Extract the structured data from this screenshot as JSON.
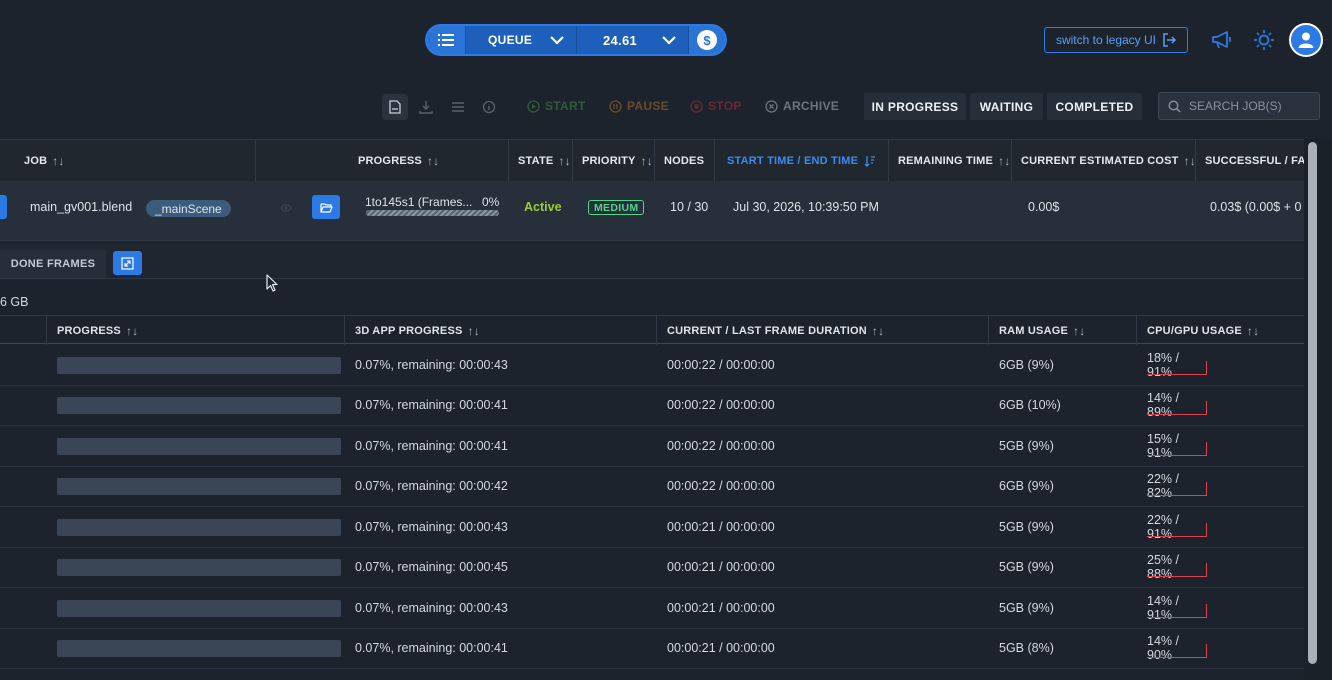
{
  "colors": {
    "background": "#1c232d",
    "accent": "#2c7be5",
    "active": "#9ccc3a",
    "medium_badge": "#4fd48a",
    "cpu_line": "#d9434e"
  },
  "topbar": {
    "queue_label": "QUEUE",
    "cost_value": "24.61",
    "legacy_label": "switch to legacy UI",
    "icons": [
      "list-icon",
      "chevron-down-icon",
      "dollar-icon",
      "megaphone-icon",
      "sun-icon",
      "user-icon"
    ]
  },
  "toolbar": {
    "actions": {
      "start": "START",
      "pause": "PAUSE",
      "stop": "STOP",
      "archive": "ARCHIVE"
    },
    "tabs": {
      "in_progress": "IN PROGRESS",
      "waiting": "WAITING",
      "completed": "COMPLETED"
    },
    "search_placeholder": "SEARCH JOB(S)"
  },
  "jobs_table": {
    "headers": {
      "job": "JOB",
      "progress": "PROGRESS",
      "state": "STATE",
      "priority": "PRIORITY",
      "nodes": "NODES",
      "start_end": "START TIME / END TIME",
      "remaining": "REMAINING TIME",
      "cost": "CURRENT ESTIMATED COST",
      "success": "SUCCESSFUL / FAI"
    },
    "row": {
      "job_name": "main_gv001.blend",
      "scene": "_mainScene",
      "progress_label": "1to145s1 (Frames...",
      "progress_pct": "0%",
      "progress_fraction": 0,
      "state": "Active",
      "priority": "MEDIUM",
      "nodes": "10 / 30",
      "start_time": "Jul 30, 2026, 10:39:50 PM",
      "cost": "0.00$",
      "success": "0.03$ (0.00$ + 0"
    }
  },
  "sub": {
    "done_frames": "DONE FRAMES",
    "ram_total": "6 GB",
    "headers": {
      "progress": "PROGRESS",
      "app_progress": "3D APP PROGRESS",
      "duration": "CURRENT / LAST FRAME DURATION",
      "ram": "RAM USAGE",
      "cpu": "CPU/GPU USAGE"
    },
    "rows": [
      {
        "app": "0.07%, remaining: 00:00:43",
        "duration": "00:00:22 / 00:00:00",
        "ram": "6GB (9%)",
        "cpu": "18% / 91%"
      },
      {
        "app": "0.07%, remaining: 00:00:41",
        "duration": "00:00:22 / 00:00:00",
        "ram": "6GB (10%)",
        "cpu": "14% / 89%"
      },
      {
        "app": "0.07%, remaining: 00:00:41",
        "duration": "00:00:22 / 00:00:00",
        "ram": "5GB (9%)",
        "cpu": "15% / 91%"
      },
      {
        "app": "0.07%, remaining: 00:00:42",
        "duration": "00:00:22 / 00:00:00",
        "ram": "6GB (9%)",
        "cpu": "22% / 82%"
      },
      {
        "app": "0.07%, remaining: 00:00:43",
        "duration": "00:00:21 / 00:00:00",
        "ram": "5GB (9%)",
        "cpu": "22% / 91%"
      },
      {
        "app": "0.07%, remaining: 00:00:45",
        "duration": "00:00:21 / 00:00:00",
        "ram": "5GB (9%)",
        "cpu": "25% / 88%"
      },
      {
        "app": "0.07%, remaining: 00:00:43",
        "duration": "00:00:21 / 00:00:00",
        "ram": "5GB (9%)",
        "cpu": "14% / 91%"
      },
      {
        "app": "0.07%, remaining: 00:00:41",
        "duration": "00:00:21 / 00:00:00",
        "ram": "5GB (8%)",
        "cpu": "14% / 90%"
      }
    ]
  }
}
